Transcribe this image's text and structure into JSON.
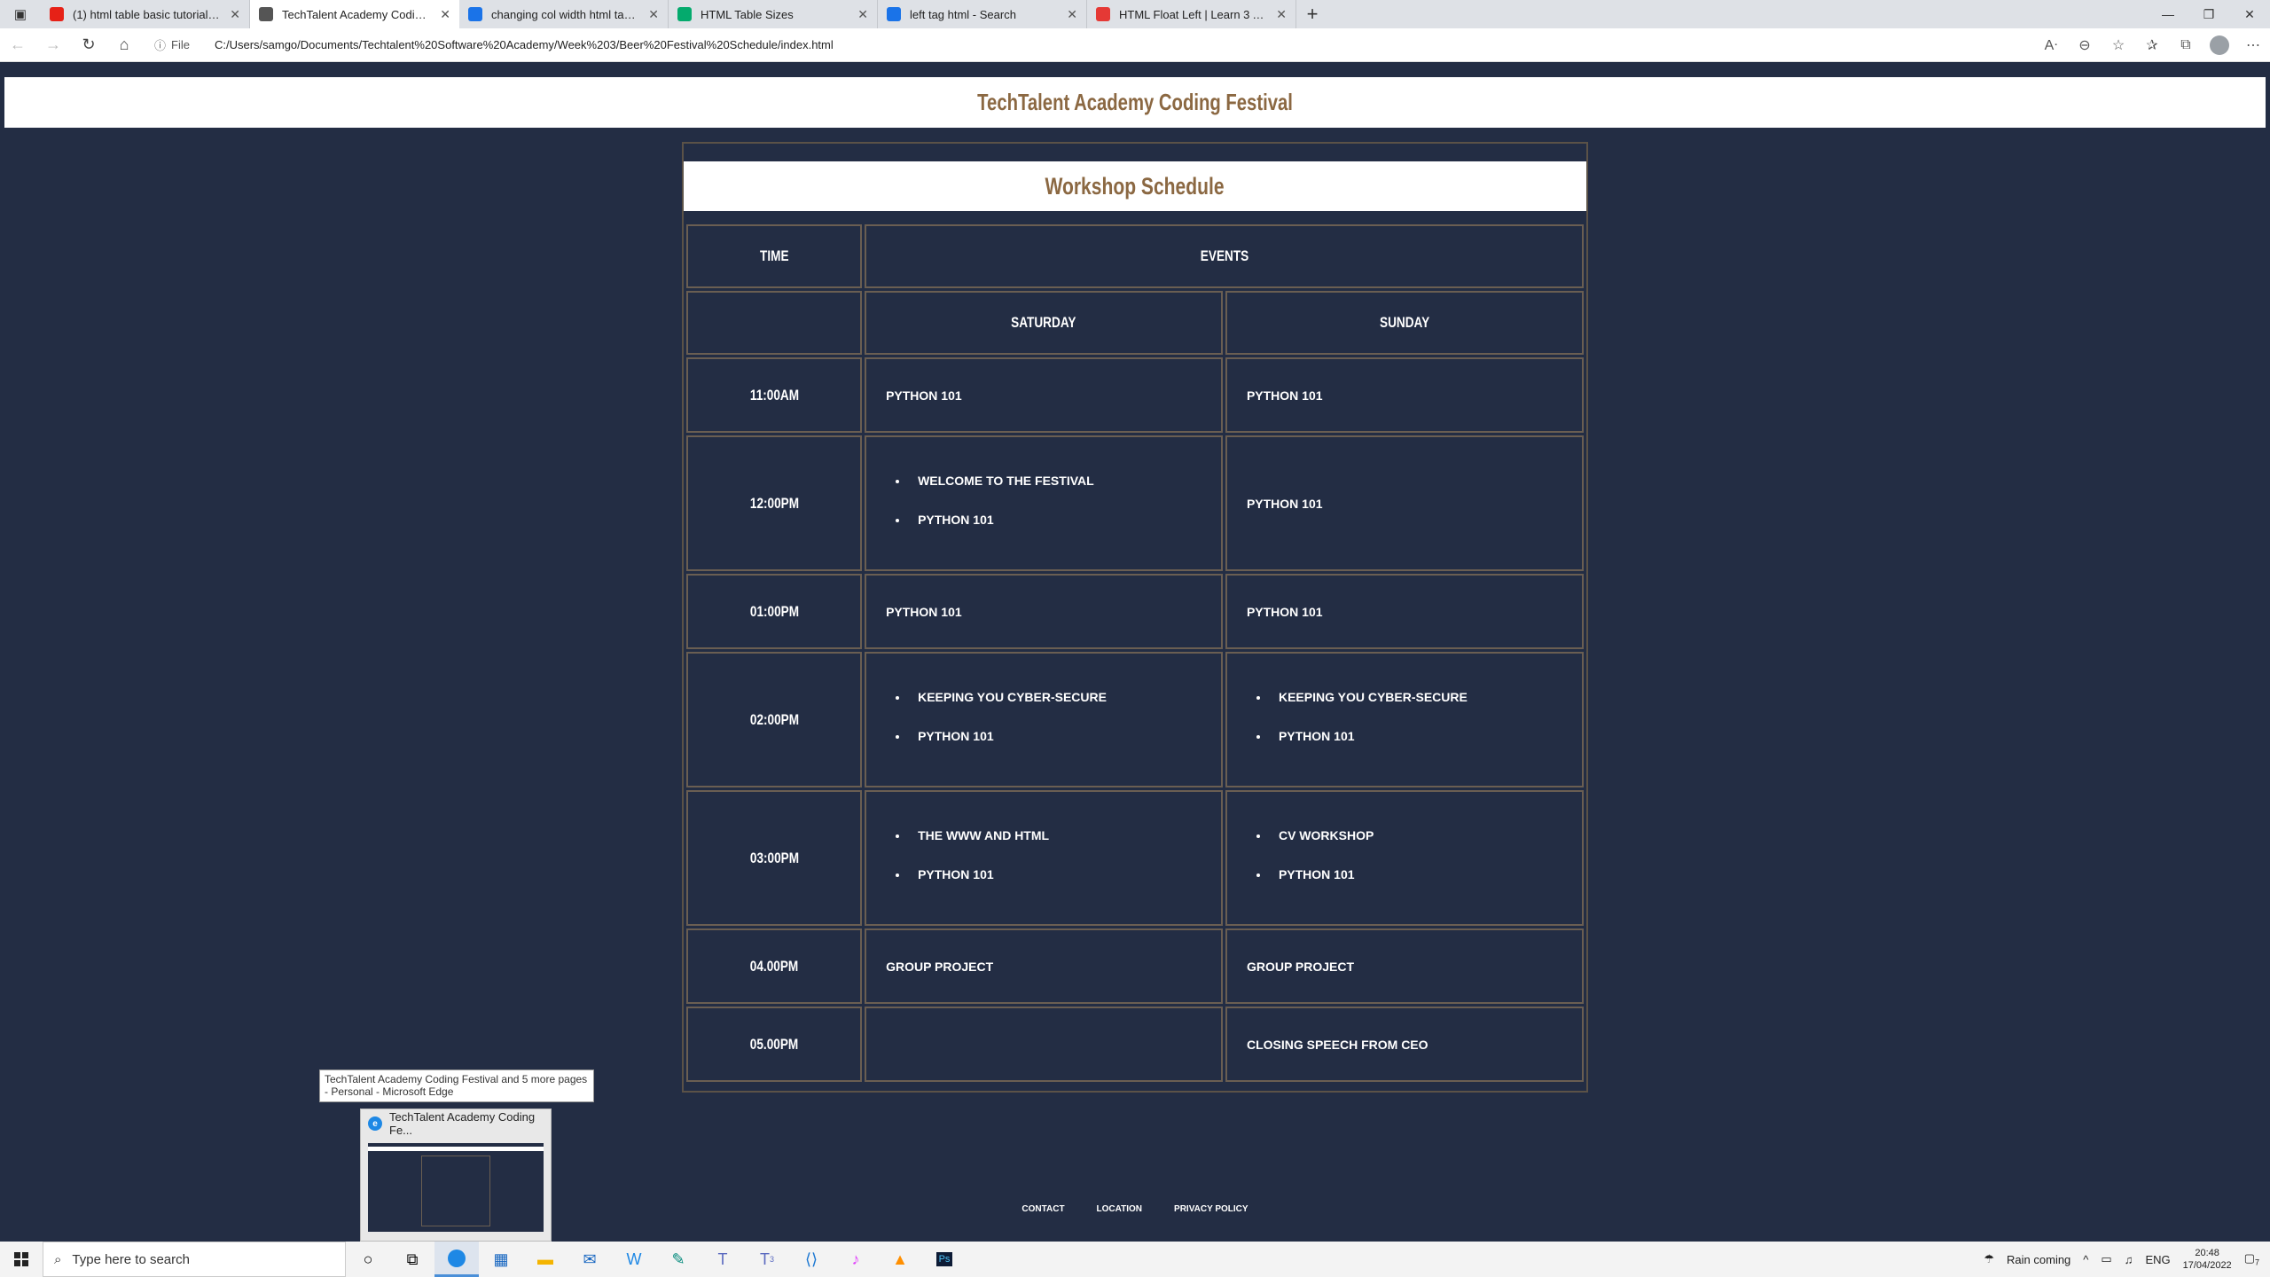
{
  "browser": {
    "tabs": [
      {
        "title": "(1) html table basic tutorial | htm",
        "icon": "youtube-icon",
        "color": "#e62117"
      },
      {
        "title": "TechTalent Academy Coding Festi",
        "icon": "page-icon",
        "color": "#555555",
        "active": true
      },
      {
        "title": "changing col width html table - ",
        "icon": "bing-icon",
        "color": "#1a73e8"
      },
      {
        "title": "HTML Table Sizes",
        "icon": "w3schools-icon",
        "color": "#04aa6d"
      },
      {
        "title": "left tag html - Search",
        "icon": "bing-icon",
        "color": "#1a73e8"
      },
      {
        "title": "HTML Float Left | Learn 3 Aweso",
        "icon": "educba-icon",
        "color": "#e53935"
      }
    ],
    "address": {
      "scheme_label": "File",
      "url": "C:/Users/samgo/Documents/Techtalent%20Software%20Academy/Week%203/Beer%20Festival%20Schedule/index.html"
    }
  },
  "page": {
    "site_title": "TechTalent Academy Coding Festival",
    "schedule_title": "Workshop Schedule",
    "headers": {
      "time": "TIME",
      "events": "EVENTS",
      "saturday": "SATURDAY",
      "sunday": "SUNDAY"
    },
    "rows": [
      {
        "time": "11:00AM",
        "sat": [
          "PYTHON 101"
        ],
        "sun": [
          "PYTHON 101"
        ]
      },
      {
        "time": "12:00PM",
        "sat": [
          "WELCOME TO THE FESTIVAL",
          "PYTHON 101"
        ],
        "sun": [
          "PYTHON 101"
        ]
      },
      {
        "time": "01:00PM",
        "sat": [
          "PYTHON 101"
        ],
        "sun": [
          "PYTHON 101"
        ]
      },
      {
        "time": "02:00PM",
        "sat": [
          "KEEPING YOU CYBER-SECURE",
          "PYTHON 101"
        ],
        "sun": [
          "KEEPING YOU CYBER-SECURE",
          "PYTHON 101"
        ]
      },
      {
        "time": "03:00PM",
        "sat": [
          "THE WWW AND HTML",
          "PYTHON 101"
        ],
        "sun": [
          "CV WORKSHOP",
          "PYTHON 101"
        ]
      },
      {
        "time": "04.00PM",
        "sat": [
          "GROUP PROJECT"
        ],
        "sun": [
          "GROUP PROJECT"
        ]
      },
      {
        "time": "05.00PM",
        "sat": [],
        "sun": [
          "CLOSING SPEECH FROM CEO"
        ]
      }
    ],
    "footer": [
      "CONTACT",
      "LOCATION",
      "PRIVACY POLICY"
    ]
  },
  "taskbar": {
    "tooltip": "TechTalent Academy Coding Festival and 5 more pages - Personal - Microsoft Edge",
    "thumb_title": "TechTalent Academy Coding Fe...",
    "search_placeholder": "Type here to search",
    "weather": "Rain coming",
    "lang": "ENG",
    "time": "20:48",
    "date": "17/04/2022",
    "teams_badge": "3",
    "notification_count": "7"
  }
}
